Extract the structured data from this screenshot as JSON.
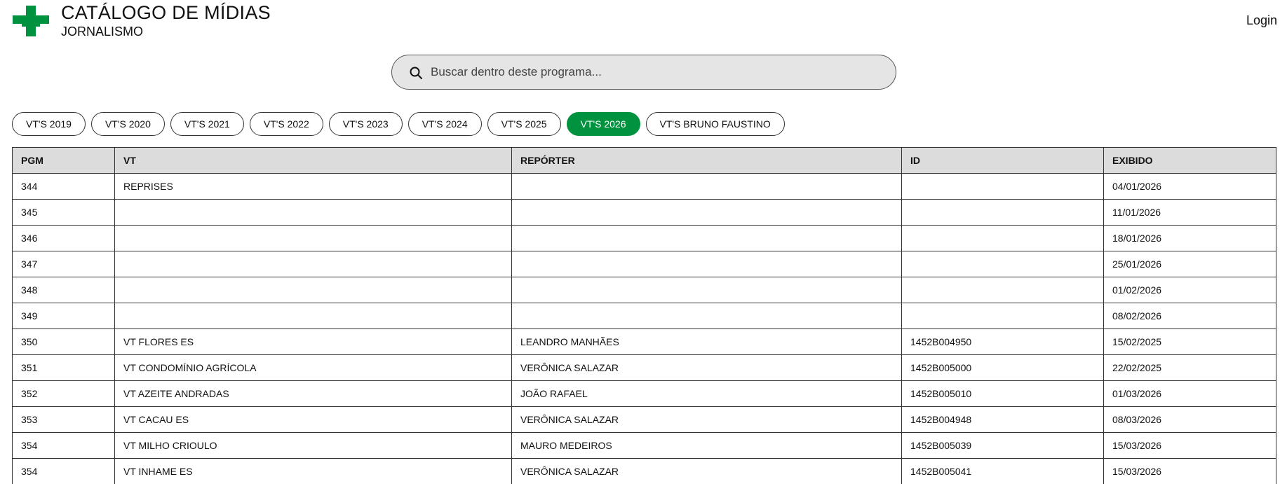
{
  "header": {
    "title": "CATÁLOGO DE MÍDIAS",
    "subtitle": "JORNALISMO",
    "login_label": "Login",
    "logo_icon": "green-cross-logo-icon",
    "brand_color": "#00923f"
  },
  "search": {
    "placeholder": "Buscar dentro deste programa...",
    "value": "",
    "icon": "search-icon"
  },
  "tabs": [
    {
      "label": "VT'S 2019",
      "active": false
    },
    {
      "label": "VT'S 2020",
      "active": false
    },
    {
      "label": "VT'S 2021",
      "active": false
    },
    {
      "label": "VT'S 2022",
      "active": false
    },
    {
      "label": "VT'S 2023",
      "active": false
    },
    {
      "label": "VT'S 2024",
      "active": false
    },
    {
      "label": "VT'S 2025",
      "active": false
    },
    {
      "label": "VT'S 2026",
      "active": true
    },
    {
      "label": "VT'S BRUNO FAUSTINO",
      "active": false
    }
  ],
  "table": {
    "columns": [
      "PGM",
      "VT",
      "REPÓRTER",
      "ID",
      "EXIBIDO"
    ],
    "rows": [
      [
        "344",
        "REPRISES",
        "",
        "",
        "04/01/2026"
      ],
      [
        "345",
        "",
        "",
        "",
        "11/01/2026"
      ],
      [
        "346",
        "",
        "",
        "",
        "18/01/2026"
      ],
      [
        "347",
        "",
        "",
        "",
        "25/01/2026"
      ],
      [
        "348",
        "",
        "",
        "",
        "01/02/2026"
      ],
      [
        "349",
        "",
        "",
        "",
        "08/02/2026"
      ],
      [
        "350",
        "VT FLORES ES",
        "LEANDRO MANHÃES",
        "1452B004950",
        "15/02/2025"
      ],
      [
        "351",
        "VT CONDOMÍNIO AGRÍCOLA",
        "VERÔNICA SALAZAR",
        "1452B005000",
        "22/02/2025"
      ],
      [
        "352",
        "VT AZEITE ANDRADAS",
        "JOÃO RAFAEL",
        "1452B005010",
        "01/03/2026"
      ],
      [
        "353",
        "VT CACAU ES",
        "VERÔNICA SALAZAR",
        "1452B004948",
        "08/03/2026"
      ],
      [
        "354",
        "VT MILHO CRIOULO",
        "MAURO MEDEIROS",
        "1452B005039",
        "15/03/2026"
      ],
      [
        "354",
        "VT INHAME ES",
        "VERÔNICA SALAZAR",
        "1452B005041",
        "15/03/2026"
      ]
    ]
  }
}
